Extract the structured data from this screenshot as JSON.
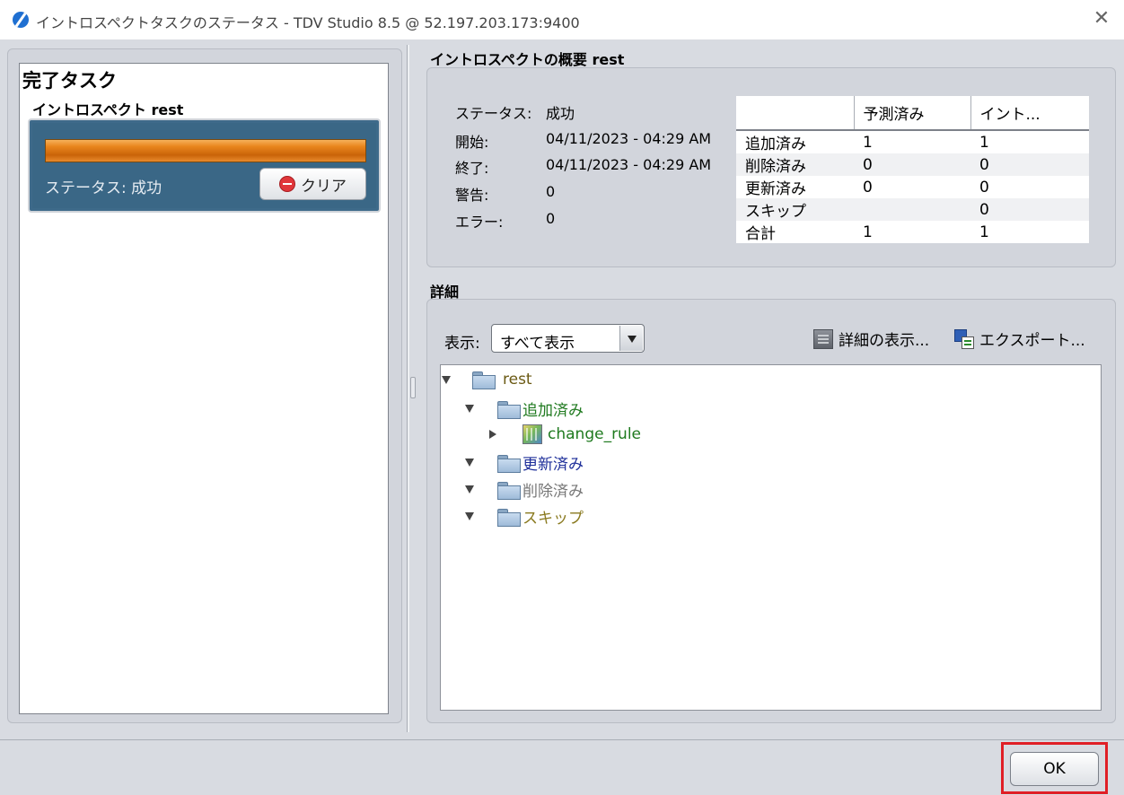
{
  "window": {
    "title": "イントロスペクトタスクのステータス - TDV Studio 8.5 @ 52.197.203.173:9400",
    "close_glyph": "✕"
  },
  "left": {
    "heading": "完了タスク",
    "task": {
      "name": "イントロスペクト rest",
      "progress": 1.0,
      "status": "ステータス: 成功",
      "clear_label": "クリア"
    }
  },
  "summary": {
    "heading": "イントロスペクトの概要  rest",
    "fields": [
      {
        "label": "ステータス:",
        "value": "成功"
      },
      {
        "label": "開始:",
        "value": "04/11/2023 - 04:29 AM"
      },
      {
        "label": "終了:",
        "value": "04/11/2023 - 04:29 AM"
      },
      {
        "label": "警告:",
        "value": "0"
      },
      {
        "label": "エラー:",
        "value": "0"
      }
    ],
    "table": {
      "headers": [
        "",
        "予測済み",
        "イント..."
      ],
      "rows": [
        [
          "追加済み",
          "1",
          "1"
        ],
        [
          "削除済み",
          "0",
          "0"
        ],
        [
          "更新済み",
          "0",
          "0"
        ],
        [
          "スキップ",
          "",
          "0"
        ],
        [
          "合計",
          "1",
          "1"
        ]
      ]
    }
  },
  "details": {
    "heading": "詳細",
    "show_label": "表示:",
    "filter_value": "すべて表示",
    "show_details_label": "詳細の表示...",
    "export_label": "エクスポート...",
    "tree": {
      "root": "rest",
      "added": "追加済み",
      "added_child": "change_rule",
      "updated": "更新済み",
      "deleted": "削除済み",
      "skipped": "スキップ"
    },
    "colors": {
      "root": "#6b5a14",
      "added": "#1f7a1f",
      "updated": "#1e2f9a",
      "deleted": "#777777",
      "skipped": "#8a7a20"
    }
  },
  "footer": {
    "ok_label": "OK"
  }
}
